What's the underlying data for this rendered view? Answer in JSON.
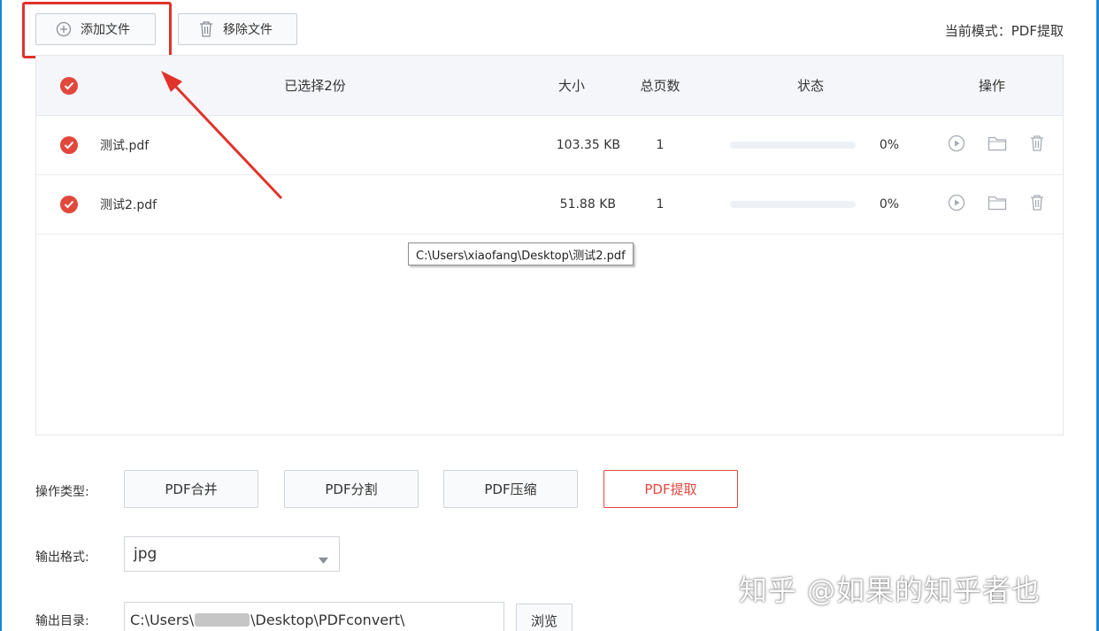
{
  "toolbar": {
    "add_label": "添加文件",
    "remove_label": "移除文件",
    "mode_label": "当前模式：PDF提取"
  },
  "table": {
    "headers": {
      "selected": "已选择2份",
      "size": "大小",
      "pages": "总页数",
      "status": "状态",
      "ops": "操作"
    },
    "rows": [
      {
        "name": "测试.pdf",
        "size": "103.35 KB",
        "pages": "1",
        "progress": 0,
        "percent": "0%"
      },
      {
        "name": "测试2.pdf",
        "size": "51.88 KB",
        "pages": "1",
        "progress": 0,
        "percent": "0%"
      }
    ]
  },
  "tooltip": "C:\\Users\\xiaofang\\Desktop\\测试2.pdf",
  "options": {
    "op_type_label": "操作类型:",
    "op_types": [
      "PDF合并",
      "PDF分割",
      "PDF压缩",
      "PDF提取"
    ],
    "active_op": "PDF提取",
    "format_label": "输出格式:",
    "format_value": "jpg",
    "dir_label": "输出目录:",
    "dir_prefix": "C:\\Users\\",
    "dir_suffix": "\\Desktop\\PDFconvert\\",
    "browse_label": "浏览"
  },
  "watermark": "知乎 @如果的知乎者也",
  "colors": {
    "accent_red": "#e2473c",
    "annotation_red": "#e0332a",
    "progress_blue": "#2f8de4",
    "window_edge": "#1a87d6"
  },
  "icons": [
    "plus-circle-icon",
    "trash-icon",
    "check-circle-icon",
    "play-icon",
    "folder-icon",
    "chevron-down-icon"
  ]
}
